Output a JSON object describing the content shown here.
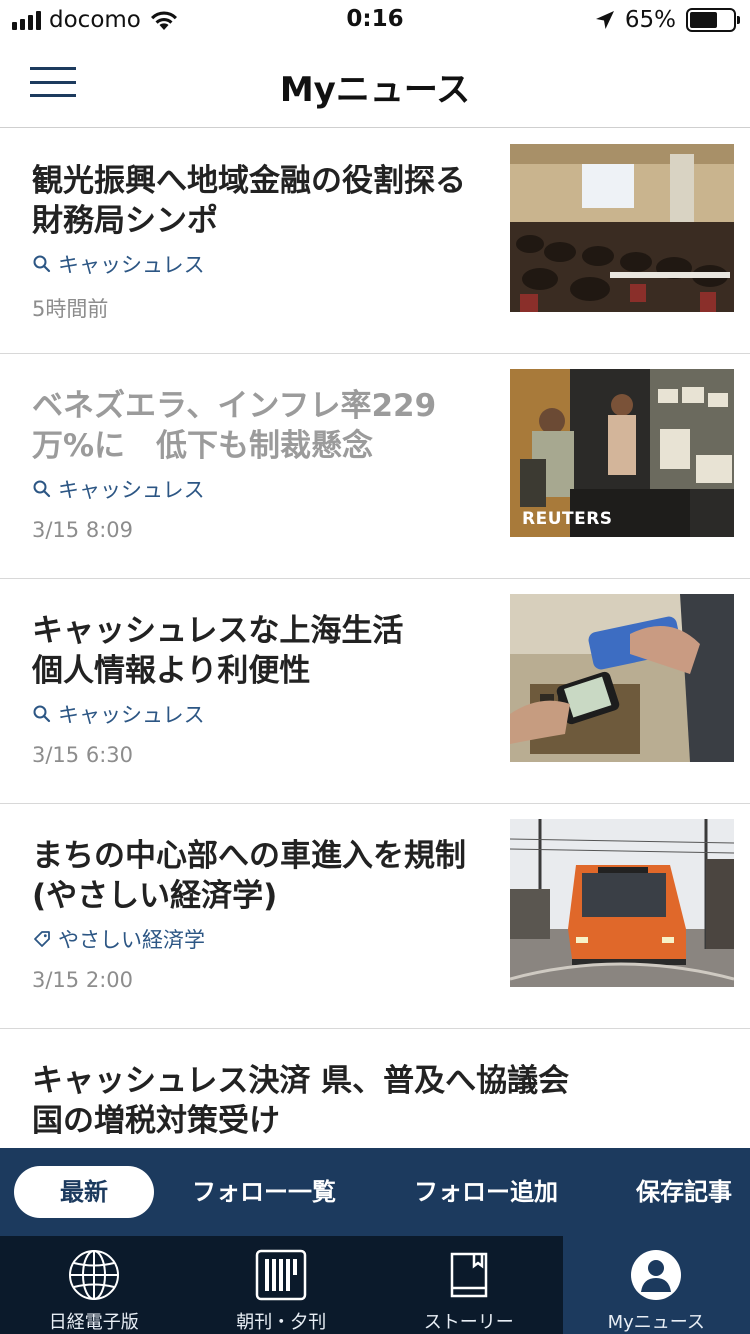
{
  "status_bar": {
    "carrier": "docomo",
    "time": "0:16",
    "battery_percent_text": "65%",
    "battery_level": 0.65
  },
  "nav": {
    "title": "Myニュース",
    "menu_icon": "hamburger-menu-icon"
  },
  "articles": [
    {
      "headline": "観光振興へ地域金融の役割探る\n財務局シンポ",
      "tag": "キャッシュレス",
      "tag_icon": "search-icon",
      "time": "5時間前",
      "read": false,
      "thumb_credit": ""
    },
    {
      "headline": "ベネズエラ、インフレ率229\n万%に　低下も制裁懸念",
      "tag": "キャッシュレス",
      "tag_icon": "search-icon",
      "time": "3/15 8:09",
      "read": true,
      "thumb_credit": "REUTERS"
    },
    {
      "headline": "キャッシュレスな上海生活\n個人情報より利便性",
      "tag": "キャッシュレス",
      "tag_icon": "search-icon",
      "time": "3/15 6:30",
      "read": false,
      "thumb_credit": ""
    },
    {
      "headline": "まちの中心部への車進入を規制\n(やさしい経済学)",
      "tag": "やさしい経済学",
      "tag_icon": "tag-icon",
      "time": "3/15 2:00",
      "read": false,
      "thumb_credit": ""
    },
    {
      "headline": "キャッシュレス決済 県、普及へ協議会\n国の増税対策受け",
      "tag": "",
      "tag_icon": "",
      "time": "",
      "read": false,
      "thumb_credit": ""
    }
  ],
  "segments": [
    {
      "label": "最新",
      "active": true
    },
    {
      "label": "フォロー一覧",
      "active": false
    },
    {
      "label": "フォロー追加",
      "active": false
    },
    {
      "label": "保存記事",
      "active": false
    }
  ],
  "tabs": [
    {
      "label": "日経電子版",
      "icon": "globe-icon",
      "active": false
    },
    {
      "label": "朝刊・夕刊",
      "icon": "newspaper-icon",
      "active": false
    },
    {
      "label": "ストーリー",
      "icon": "book-icon",
      "active": false
    },
    {
      "label": "Myニュース",
      "icon": "user-avatar-icon",
      "active": true
    }
  ],
  "colors": {
    "brand_navy": "#1c3a5e",
    "tab_bar_dark": "#0b1a2b",
    "tag_blue": "#2c5684",
    "read_gray": "#9b9b9b"
  }
}
